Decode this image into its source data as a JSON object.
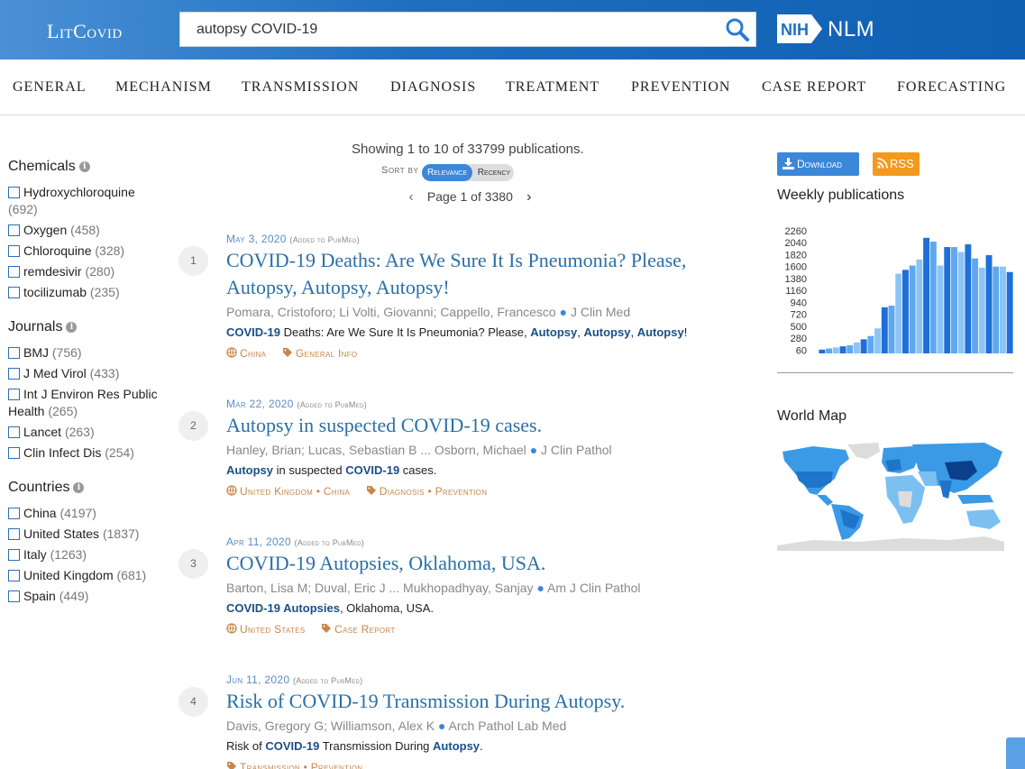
{
  "header": {
    "logo": "LitCovid",
    "search_value": "autopsy COVID-19",
    "nih_logo": "NIH",
    "nlm_label": "NLM"
  },
  "categories": [
    "GENERAL",
    "MECHANISM",
    "TRANSMISSION",
    "DIAGNOSIS",
    "TREATMENT",
    "PREVENTION",
    "CASE REPORT",
    "FORECASTING"
  ],
  "sidebar": {
    "chemicals": {
      "title": "Chemicals",
      "items": [
        {
          "label": "Hydroxychloroquine",
          "count": "(692)"
        },
        {
          "label": "Oxygen",
          "count": "(458)"
        },
        {
          "label": "Chloroquine",
          "count": "(328)"
        },
        {
          "label": "remdesivir",
          "count": "(280)"
        },
        {
          "label": "tocilizumab",
          "count": "(235)"
        }
      ]
    },
    "journals": {
      "title": "Journals",
      "items": [
        {
          "label": "BMJ",
          "count": "(756)"
        },
        {
          "label": "J Med Virol",
          "count": "(433)"
        },
        {
          "label": "Int J Environ Res Public Health",
          "count": "(265)"
        },
        {
          "label": "Lancet",
          "count": "(263)"
        },
        {
          "label": "Clin Infect Dis",
          "count": "(254)"
        }
      ]
    },
    "countries": {
      "title": "Countries",
      "items": [
        {
          "label": "China",
          "count": "(4197)"
        },
        {
          "label": "United States",
          "count": "(1837)"
        },
        {
          "label": "Italy",
          "count": "(1263)"
        },
        {
          "label": "United Kingdom",
          "count": "(681)"
        },
        {
          "label": "Spain",
          "count": "(449)"
        }
      ]
    }
  },
  "results_header": {
    "showing": "Showing 1 to 10 of 33799 publications.",
    "sort_by": "Sort by",
    "sort_relevance": "Relevance",
    "sort_recency": "Recency",
    "page": "Page 1 of 3380"
  },
  "results": [
    {
      "num": "1",
      "date": "May 3, 2020",
      "added": "(Added to PubMed)",
      "title": "COVID-19 Deaths: Are We Sure It Is Pneumonia? Please, Autopsy, Autopsy, Autopsy!",
      "authors": "Pomara, Cristoforo; Li Volti, Giovanni; Cappello, Francesco",
      "journal": "J Clin Med",
      "snippet_html": "<b>COVID-19</b> Deaths: Are We Sure It Is Pneumonia? Please, <b>Autopsy</b>, <b>Autopsy</b>, <b>Autopsy</b>!",
      "locations": "China",
      "topics": "General Info"
    },
    {
      "num": "2",
      "date": "Mar 22, 2020",
      "added": "(Added to PubMed)",
      "title": "Autopsy in suspected COVID-19 cases.",
      "authors": "Hanley, Brian; Lucas, Sebastian B ... Osborn, Michael",
      "journal": "J Clin Pathol",
      "snippet_html": "<b>Autopsy</b> in suspected <b>COVID-19</b> cases.",
      "locations": "United Kingdom • China",
      "topics": "Diagnosis • Prevention"
    },
    {
      "num": "3",
      "date": "Apr 11, 2020",
      "added": "(Added to PubMed)",
      "title": "COVID-19 Autopsies, Oklahoma, USA.",
      "authors": "Barton, Lisa M; Duval, Eric J ... Mukhopadhyay, Sanjay",
      "journal": "Am J Clin Pathol",
      "snippet_html": "<b>COVID-19 Autopsies</b>, Oklahoma, USA.",
      "locations": "United States",
      "topics": "Case Report"
    },
    {
      "num": "4",
      "date": "Jun 11, 2020",
      "added": "(Added to PubMed)",
      "title": "Risk of COVID-19 Transmission During Autopsy.",
      "authors": "Davis, Gregory G; Williamson, Alex K",
      "journal": "Arch Pathol Lab Med",
      "snippet_html": "Risk of <b>COVID-19</b> Transmission During <b>Autopsy</b>.",
      "locations": "",
      "topics": "Transmission • Prevention"
    }
  ],
  "right_panel": {
    "download_label": "Download",
    "rss_label": "RSS",
    "weekly_title": "Weekly publications",
    "map_title": "World Map"
  },
  "chart_data": {
    "type": "bar",
    "title": "Weekly publications",
    "y_ticks": [
      "2260",
      "2040",
      "1820",
      "1600",
      "1380",
      "1160",
      "940",
      "720",
      "500",
      "280",
      "60"
    ],
    "ylim": [
      60,
      2260
    ],
    "values": [
      70,
      90,
      110,
      130,
      150,
      200,
      260,
      320,
      460,
      850,
      880,
      1470,
      1540,
      1620,
      1730,
      2130,
      2060,
      1620,
      1960,
      1960,
      1870,
      2010,
      1750,
      1580,
      1810,
      1600,
      1600,
      1500
    ],
    "colors": [
      "#1e6fd9",
      "#5ea8f0",
      "#8cc4f5"
    ],
    "grid": false
  },
  "map_colors": {
    "china": "#0b3f8a",
    "high": "#1e74c8",
    "mid": "#3a9ae6",
    "low": "#7cc0f2",
    "none": "#dcdcdc"
  },
  "icons": {
    "search": "search-icon",
    "download": "download-icon",
    "rss": "rss-icon",
    "globe": "globe-icon",
    "tag": "tag-icon",
    "info": "info-icon"
  }
}
